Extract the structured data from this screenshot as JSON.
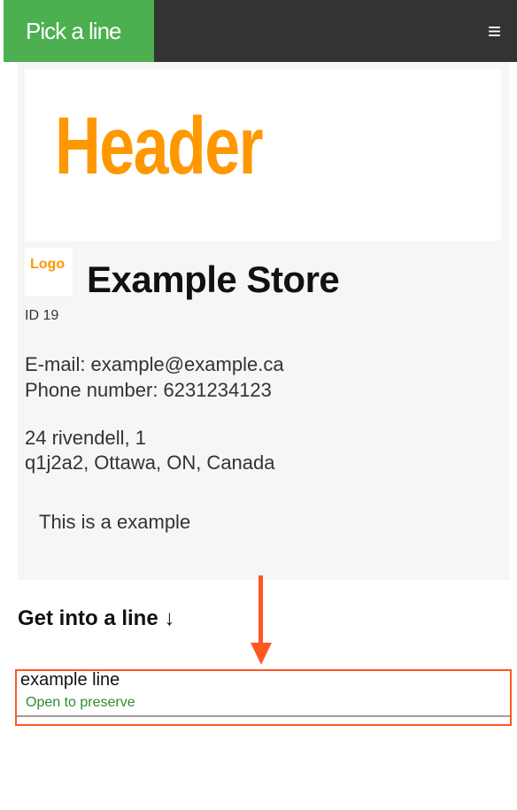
{
  "navbar": {
    "brand": "Pick a line",
    "menu_icon": "hamburger-menu-icon"
  },
  "store": {
    "header_image_text": "Header",
    "logo_text": "Logo",
    "name": "Example Store",
    "id_text": "ID 19",
    "email_line": "E-mail: example@example.ca",
    "phone_line": "Phone number: 6231234123",
    "address_line1": "24 rivendell, 1",
    "address_line2": "q1j2a2, Ottawa, ON, Canada",
    "description": "This is a example"
  },
  "lines_section": {
    "title": "Get into a line ↓",
    "items": [
      {
        "name": "example line",
        "status": "Open to preserve"
      }
    ]
  },
  "colors": {
    "brand_green": "#4caf50",
    "navbar_dark": "#333333",
    "header_orange": "#ff9800",
    "highlight_orange": "#ff5722",
    "status_green": "#2e8b2e"
  }
}
